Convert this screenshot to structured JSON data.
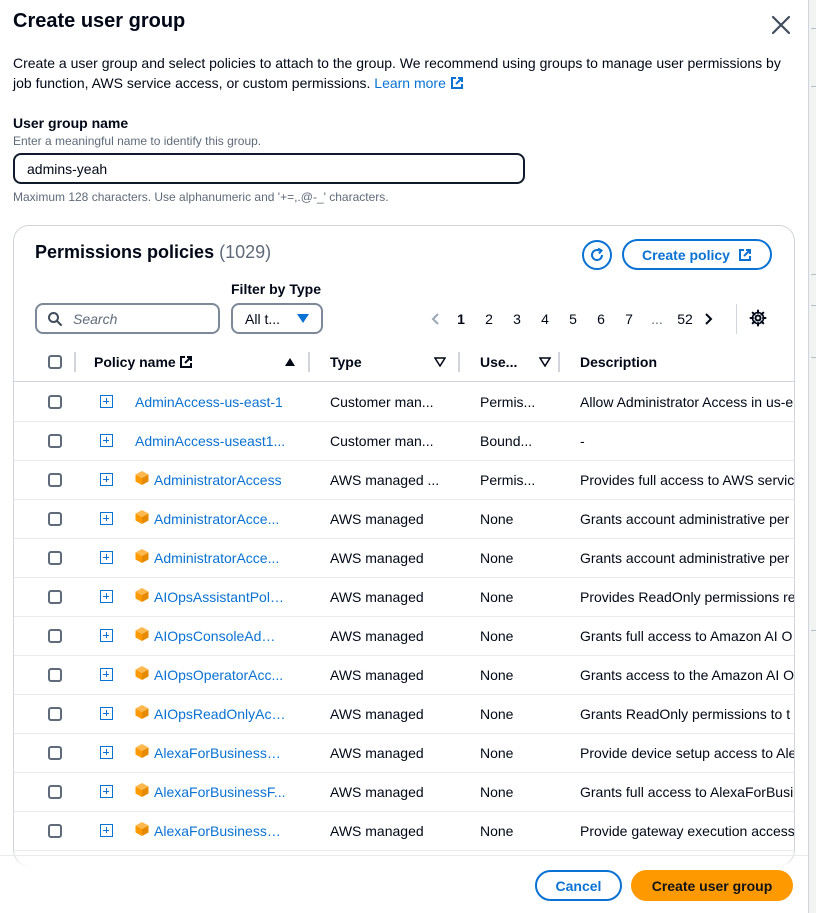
{
  "dialog": {
    "title": "Create user group",
    "description": "Create a user group and select policies to attach to the group. We recommend using groups to manage user permissions by job function, AWS service access, or custom permissions.",
    "learn_more": "Learn more"
  },
  "group_name": {
    "label": "User group name",
    "hint": "Enter a meaningful name to identify this group.",
    "value": "admins-yeah",
    "constraint": "Maximum 128 characters. Use alphanumeric and '+=,.@-_' characters."
  },
  "policies": {
    "title": "Permissions policies",
    "count": "(1029)",
    "create_policy_label": "Create policy",
    "filter_label": "Filter by Type",
    "search_placeholder": "Search",
    "filter_value": "All t...",
    "pagination": {
      "pages": [
        "1",
        "2",
        "3",
        "4",
        "5",
        "6",
        "7",
        "...",
        "52"
      ],
      "current": "1"
    },
    "columns": {
      "name": "Policy name",
      "type": "Type",
      "used_as": "Use...",
      "description": "Description"
    },
    "rows": [
      {
        "name": "AdminAccess-us-east-1",
        "type": "Customer man...",
        "used_as": "Permis...",
        "description": "Allow Administrator Access in us-e",
        "aws_managed": false
      },
      {
        "name": "AdminAccess-useast1...",
        "type": "Customer man...",
        "used_as": "Bound...",
        "description": "-",
        "aws_managed": false
      },
      {
        "name": "AdministratorAccess",
        "type": "AWS managed ...",
        "used_as": "Permis...",
        "description": "Provides full access to AWS servic",
        "aws_managed": true
      },
      {
        "name": "AdministratorAcce...",
        "type": "AWS managed",
        "used_as": "None",
        "description": "Grants account administrative per",
        "aws_managed": true
      },
      {
        "name": "AdministratorAcce...",
        "type": "AWS managed",
        "used_as": "None",
        "description": "Grants account administrative per",
        "aws_managed": true
      },
      {
        "name": "AIOpsAssistantPolicy",
        "type": "AWS managed",
        "used_as": "None",
        "description": "Provides ReadOnly permissions re",
        "aws_managed": true
      },
      {
        "name": "AIOpsConsoleAdmi...",
        "type": "AWS managed",
        "used_as": "None",
        "description": "Grants full access to Amazon AI O",
        "aws_managed": true
      },
      {
        "name": "AIOpsOperatorAcc...",
        "type": "AWS managed",
        "used_as": "None",
        "description": "Grants access to the Amazon AI O",
        "aws_managed": true
      },
      {
        "name": "AIOpsReadOnlyAcc...",
        "type": "AWS managed",
        "used_as": "None",
        "description": "Grants ReadOnly permissions to t",
        "aws_managed": true
      },
      {
        "name": "AlexaForBusinessD...",
        "type": "AWS managed",
        "used_as": "None",
        "description": "Provide device setup access to Ale",
        "aws_managed": true
      },
      {
        "name": "AlexaForBusinessF...",
        "type": "AWS managed",
        "used_as": "None",
        "description": "Grants full access to AlexaForBusi",
        "aws_managed": true
      },
      {
        "name": "AlexaForBusinessG...",
        "type": "AWS managed",
        "used_as": "None",
        "description": "Provide gateway execution access",
        "aws_managed": true
      }
    ]
  },
  "footer": {
    "cancel_label": "Cancel",
    "create_label": "Create user group"
  },
  "colors": {
    "link": "#0972d3",
    "primary_button": "#ff9900",
    "aws_icon": "#ff9900"
  },
  "icons": {
    "close": "close-icon",
    "external_link": "external-link-icon",
    "refresh": "refresh-icon",
    "search": "search-icon",
    "settings": "gear-icon",
    "aws_managed": "aws-cube-icon",
    "expand": "expand-plus-icon"
  }
}
